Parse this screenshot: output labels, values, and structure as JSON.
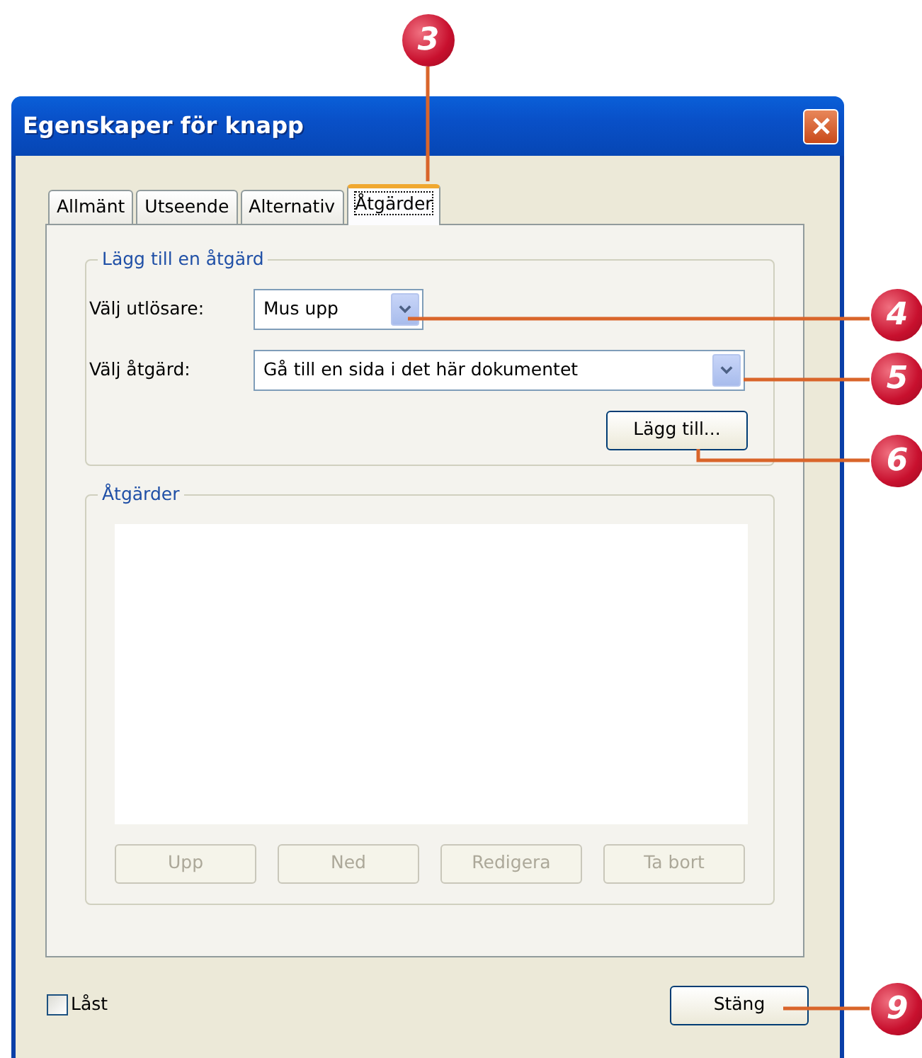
{
  "window": {
    "title": "Egenskaper för knapp"
  },
  "tabs": [
    {
      "label": "Allmänt",
      "selected": false
    },
    {
      "label": "Utseende",
      "selected": false
    },
    {
      "label": "Alternativ",
      "selected": false
    },
    {
      "label": "Åtgärder",
      "selected": true
    }
  ],
  "add_action": {
    "legend": "Lägg till en åtgärd",
    "fields": [
      {
        "label": "Välj utlösare:",
        "value": "Mus upp"
      },
      {
        "label": "Välj åtgärd:",
        "value": "Gå till en sida i det här dokumentet"
      }
    ],
    "button": {
      "label": "Lägg till...",
      "disabled": false
    }
  },
  "actions": {
    "legend": "Åtgärder",
    "buttons": [
      {
        "label": "Upp",
        "disabled": true
      },
      {
        "label": "Ned",
        "disabled": true
      },
      {
        "label": "Redigera",
        "disabled": true
      },
      {
        "label": "Ta bort",
        "disabled": true
      }
    ]
  },
  "locked": {
    "label": "Låst",
    "checked": false
  },
  "close_button": {
    "label": "Stäng"
  },
  "callouts": [
    {
      "number": "3"
    },
    {
      "number": "4"
    },
    {
      "number": "5"
    },
    {
      "number": "6"
    },
    {
      "number": "9"
    }
  ]
}
